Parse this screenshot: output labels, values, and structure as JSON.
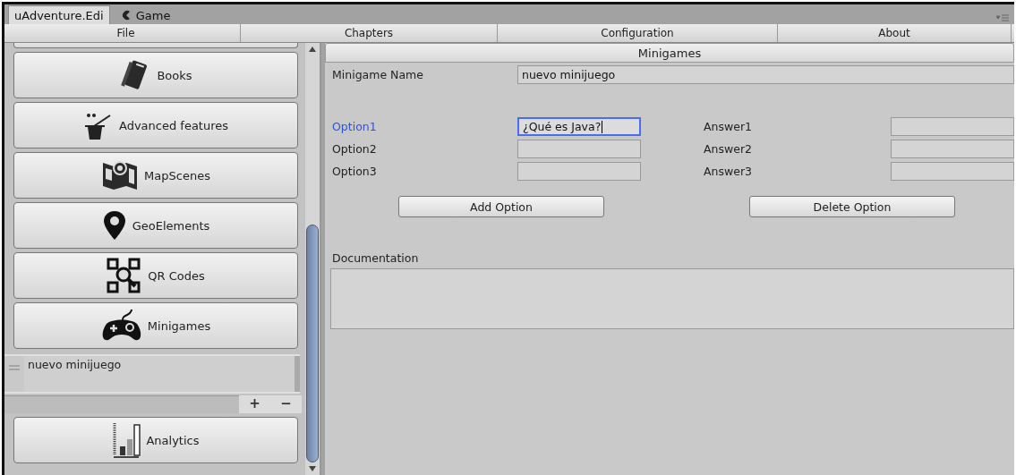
{
  "window_tabs": [
    {
      "label": "uAdventure.Edi",
      "selected": true
    },
    {
      "label": "Game",
      "selected": false
    }
  ],
  "menu": [
    "File",
    "Chapters",
    "Configuration",
    "About"
  ],
  "sidebar": {
    "items": [
      {
        "kind": "button",
        "label": "Books"
      },
      {
        "kind": "button",
        "label": "Advanced features"
      },
      {
        "kind": "button",
        "label": "MapScenes"
      },
      {
        "kind": "button",
        "label": "GeoElements"
      },
      {
        "kind": "button",
        "label": "QR Codes"
      },
      {
        "kind": "button",
        "label": "Minigames"
      },
      {
        "kind": "list",
        "entries": [
          {
            "label": "nuevo minijuego",
            "selected": false
          }
        ],
        "controls": [
          "+",
          "−"
        ]
      },
      {
        "kind": "button",
        "label": "Analytics"
      }
    ]
  },
  "panel": {
    "title": "Minigames",
    "name_label": "Minigame Name",
    "name_value": "nuevo minijuego",
    "options": [
      {
        "label": "Option1",
        "value": "¿Qué es Java?",
        "focused": true,
        "answer_label": "Answer1"
      },
      {
        "label": "Option2",
        "focused": false,
        "answer_label": "Answer2"
      },
      {
        "label": "Option3",
        "focused": false,
        "answer_label": "Answer3"
      }
    ],
    "buttons": [
      "Add Option",
      "Delete Option"
    ],
    "documentation_label": "Documentation"
  }
}
